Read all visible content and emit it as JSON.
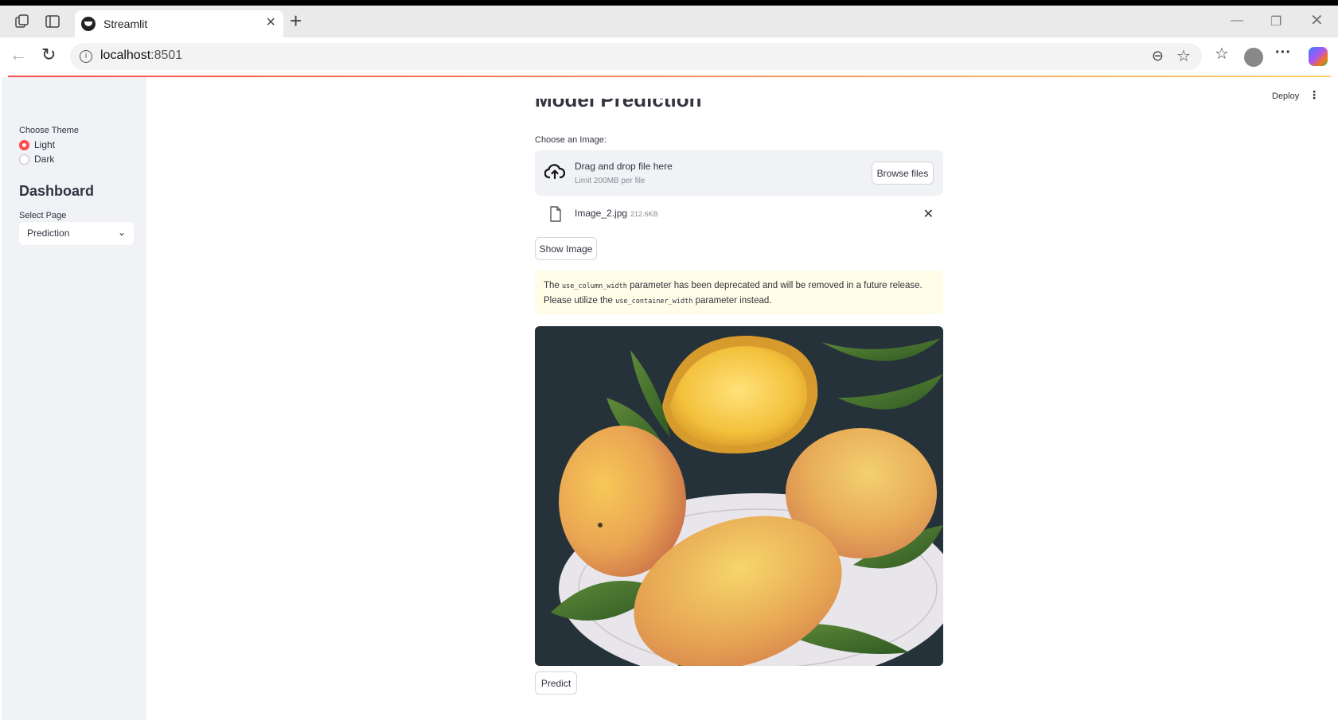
{
  "browser": {
    "tab_title": "Streamlit",
    "url_host": "localhost",
    "url_port": ":8501"
  },
  "sidebar": {
    "theme_label": "Choose Theme",
    "theme_options": [
      "Light",
      "Dark"
    ],
    "theme_selected": "Light",
    "heading": "Dashboard",
    "page_label": "Select Page",
    "page_value": "Prediction"
  },
  "header": {
    "deploy_label": "Deploy"
  },
  "main": {
    "title": "Model Prediction",
    "uploader_label": "Choose an Image:",
    "drop_text": "Drag and drop file here",
    "limit_text": "Limit 200MB per file",
    "browse_label": "Browse files",
    "file_name": "Image_2.jpg",
    "file_size": "212.6KB",
    "show_image_label": "Show Image",
    "warning": {
      "p1": "The ",
      "code1": "use_column_width",
      "p2": " parameter has been deprecated and will be removed in a future release. Please utilize the ",
      "code2": "use_container_width",
      "p3": " parameter instead."
    },
    "predict_label": "Predict"
  },
  "colors": {
    "accent": "#ff4b4b",
    "sidebar_bg": "#f0f2f6",
    "warning_bg": "#fffce7",
    "text": "#31333f"
  },
  "icons": {
    "upload": "cloud-upload-icon",
    "file": "file-icon",
    "remove": "close-icon"
  }
}
